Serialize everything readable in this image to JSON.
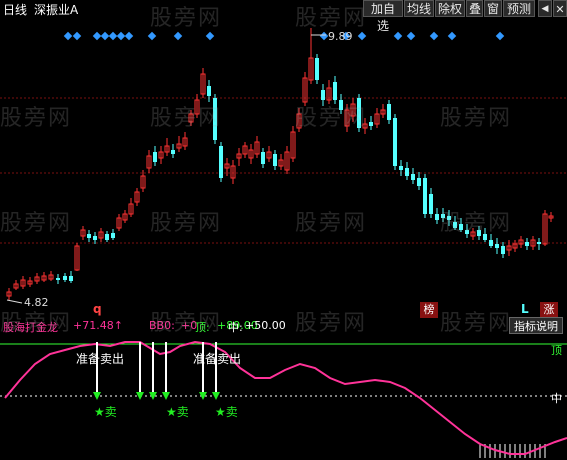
{
  "toolbar": {
    "period": "日线",
    "name": "深振业A",
    "buttons": [
      "加自选",
      "均线",
      "除权",
      "叠",
      "窗",
      "预测"
    ],
    "toggle": "◀",
    "close": "✕"
  },
  "price_chart": {
    "high_label": "9.89",
    "low_label": "4.82",
    "marker_q": "q",
    "badge_bang": "榜",
    "badge_l": "L",
    "badge_zhang": "涨",
    "up_color": "#ff3333",
    "down_color": "#55ffff",
    "signal_color": "#3399ff"
  },
  "indicator": {
    "name": "股海打金龙",
    "v1": "+71.48↑",
    "bb_label": "BB0:",
    "bb_value": "+0",
    "ding_label": "顶:",
    "ding_value": "+89.00",
    "zhong_label": "中:",
    "zhong_value": "+50.00",
    "help_button": "指标说明",
    "top_tag": "顶",
    "mid_tag": "中",
    "sell_prepare_1": "准备卖出",
    "sell_prepare_2": "准备卖出",
    "sell_1": "卖",
    "sell_2": "卖",
    "sell_3": "卖",
    "line_color": "#ff3399",
    "top_line_color": "#33ff33",
    "sell_color": "#22ee22"
  },
  "watermark": "股旁网"
}
